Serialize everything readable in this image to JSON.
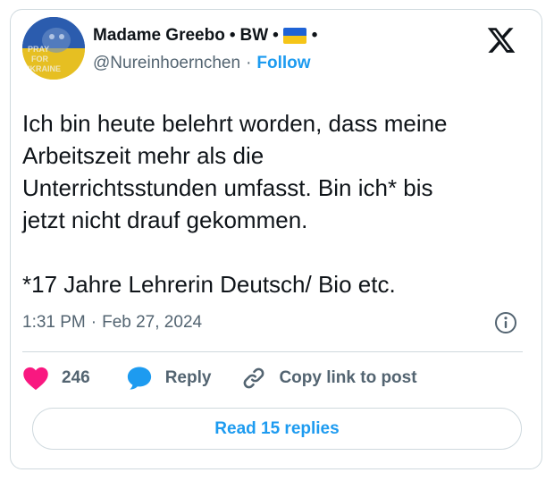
{
  "author": {
    "name": "Madame Greebo",
    "region": "BW",
    "separator": "•",
    "handle": "@Nureinhoernchen",
    "follow_label": "Follow",
    "avatar_text": "PRAY FOR UKRAINE"
  },
  "post": {
    "text": "Ich bin heute belehrt worden, dass meine\nArbeitszeit mehr als die\nUnterrichtsstunden umfasst. Bin ich* bis\njetzt nicht drauf gekommen.\n\n*17 Jahre Lehrerin Deutsch/ Bio etc.",
    "time": "1:31 PM",
    "date": "Feb 27, 2024",
    "meta_separator": "·"
  },
  "actions": {
    "likes": "246",
    "reply_label": "Reply",
    "copy_label": "Copy link to post"
  },
  "footer": {
    "read_replies_label": "Read 15 replies"
  },
  "icons": {
    "like": "heart-icon",
    "reply": "speech-bubble-icon",
    "copy": "link-icon",
    "info": "info-icon",
    "brand": "x-logo-icon",
    "flag": "ukraine-flag-icon"
  },
  "colors": {
    "accent": "#1d9bf0",
    "like": "#f91880",
    "muted": "#536471",
    "text": "#0f1419",
    "border": "#cfd9de",
    "flag_blue": "#1f63d6",
    "flag_yellow": "#f5c518"
  }
}
